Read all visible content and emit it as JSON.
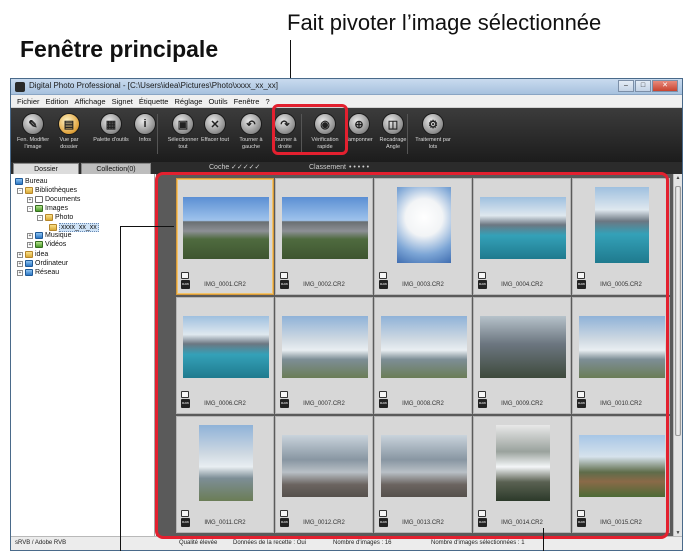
{
  "annotations": {
    "heading": "Fenêtre principale",
    "rotate_callout": "Fait pivoter l’image sélectionnée"
  },
  "window": {
    "title": "Digital Photo Professional - [C:\\Users\\idea\\Pictures\\Photo\\xxxx_xx_xx]",
    "controls": [
      "–",
      "□",
      "✕"
    ]
  },
  "menu": [
    "Fichier",
    "Edition",
    "Affichage",
    "Signet",
    "Étiquette",
    "Réglage",
    "Outils",
    "Fenêtre",
    "?"
  ],
  "toolbar": {
    "buttons": [
      {
        "label": "Fen. Modifier l'image",
        "icon": "edit-image-icon",
        "glyph": "✎"
      },
      {
        "label": "Vue par dossier",
        "icon": "folder-view-icon",
        "glyph": "▤"
      },
      {
        "label": "Palette d'outils",
        "icon": "tool-palette-icon",
        "glyph": "▦"
      },
      {
        "label": "Infos",
        "icon": "info-icon",
        "glyph": "i"
      },
      {
        "label": "Sélectionner tout",
        "icon": "select-all-icon",
        "glyph": "▣"
      },
      {
        "label": "Effacer tout",
        "icon": "clear-all-icon",
        "glyph": "✕"
      },
      {
        "label": "Tourner à gauche",
        "icon": "rotate-left-icon",
        "glyph": "↶"
      },
      {
        "label": "Tourner à droite",
        "icon": "rotate-right-icon",
        "glyph": "↷"
      },
      {
        "label": "Vérification rapide",
        "icon": "quick-check-icon",
        "glyph": "◉"
      },
      {
        "label": "Tamponner",
        "icon": "stamp-icon",
        "glyph": "⊕"
      },
      {
        "label": "Recadrage Angle",
        "icon": "crop-angle-icon",
        "glyph": "◫"
      },
      {
        "label": "Traitement par lots",
        "icon": "batch-process-icon",
        "glyph": "⚙"
      }
    ]
  },
  "tabs": {
    "folder": "Dossier",
    "collection": "Collection(0)",
    "check_label": "Coche",
    "check_marks": "✓✓✓✓✓",
    "rating_label": "Classement",
    "rating_dots": "• • • • •"
  },
  "tree": [
    {
      "label": "Bureau",
      "icon": "desktop-icon"
    },
    {
      "label": "Bibliothèques",
      "icon": "libraries-icon"
    },
    {
      "label": "Documents",
      "icon": "documents-icon"
    },
    {
      "label": "Images",
      "icon": "images-icon"
    },
    {
      "label": "Photo",
      "icon": "folder-icon"
    },
    {
      "label": "xxxx_xx_xx",
      "icon": "folder-icon"
    },
    {
      "label": "Musique",
      "icon": "music-icon"
    },
    {
      "label": "Vidéos",
      "icon": "videos-icon"
    },
    {
      "label": "idea",
      "icon": "user-folder-icon"
    },
    {
      "label": "Ordinateur",
      "icon": "computer-icon"
    },
    {
      "label": "Réseau",
      "icon": "network-icon"
    }
  ],
  "thumbnails": [
    {
      "name": "IMG_0001.CR2",
      "orientation": "landscape",
      "scene": "sky-mtn"
    },
    {
      "name": "IMG_0002.CR2",
      "orientation": "landscape",
      "scene": "sky-mtn"
    },
    {
      "name": "IMG_0003.CR2",
      "orientation": "portrait",
      "scene": "cloud"
    },
    {
      "name": "IMG_0004.CR2",
      "orientation": "landscape",
      "scene": "lake"
    },
    {
      "name": "IMG_0005.CR2",
      "orientation": "portrait",
      "scene": "lake"
    },
    {
      "name": "IMG_0006.CR2",
      "orientation": "landscape",
      "scene": "lake"
    },
    {
      "name": "IMG_0007.CR2",
      "orientation": "landscape",
      "scene": "glacier"
    },
    {
      "name": "IMG_0008.CR2",
      "orientation": "landscape",
      "scene": "glacier"
    },
    {
      "name": "IMG_0009.CR2",
      "orientation": "landscape",
      "scene": "dark"
    },
    {
      "name": "IMG_0010.CR2",
      "orientation": "landscape",
      "scene": "glacier"
    },
    {
      "name": "IMG_0011.CR2",
      "orientation": "portrait",
      "scene": "glacier"
    },
    {
      "name": "IMG_0012.CR2",
      "orientation": "landscape",
      "scene": "bus"
    },
    {
      "name": "IMG_0013.CR2",
      "orientation": "landscape",
      "scene": "bus"
    },
    {
      "name": "IMG_0014.CR2",
      "orientation": "portrait",
      "scene": "falls"
    },
    {
      "name": "IMG_0015.CR2",
      "orientation": "landscape",
      "scene": "house"
    }
  ],
  "raw_badge": "RAW",
  "status": {
    "color_space": "sRVB / Adobe RVB",
    "quality": "Qualité élevée",
    "recipe": "Données de la recette : Oui",
    "image_count": "Nombre d'images : 16",
    "selected_count": "Nombre d'images sélectionnées : 1"
  },
  "colors": {
    "highlight": "#e3202f",
    "toolbar_bg": "#2a2a2a",
    "selected_thumb": "#d79a3a"
  }
}
